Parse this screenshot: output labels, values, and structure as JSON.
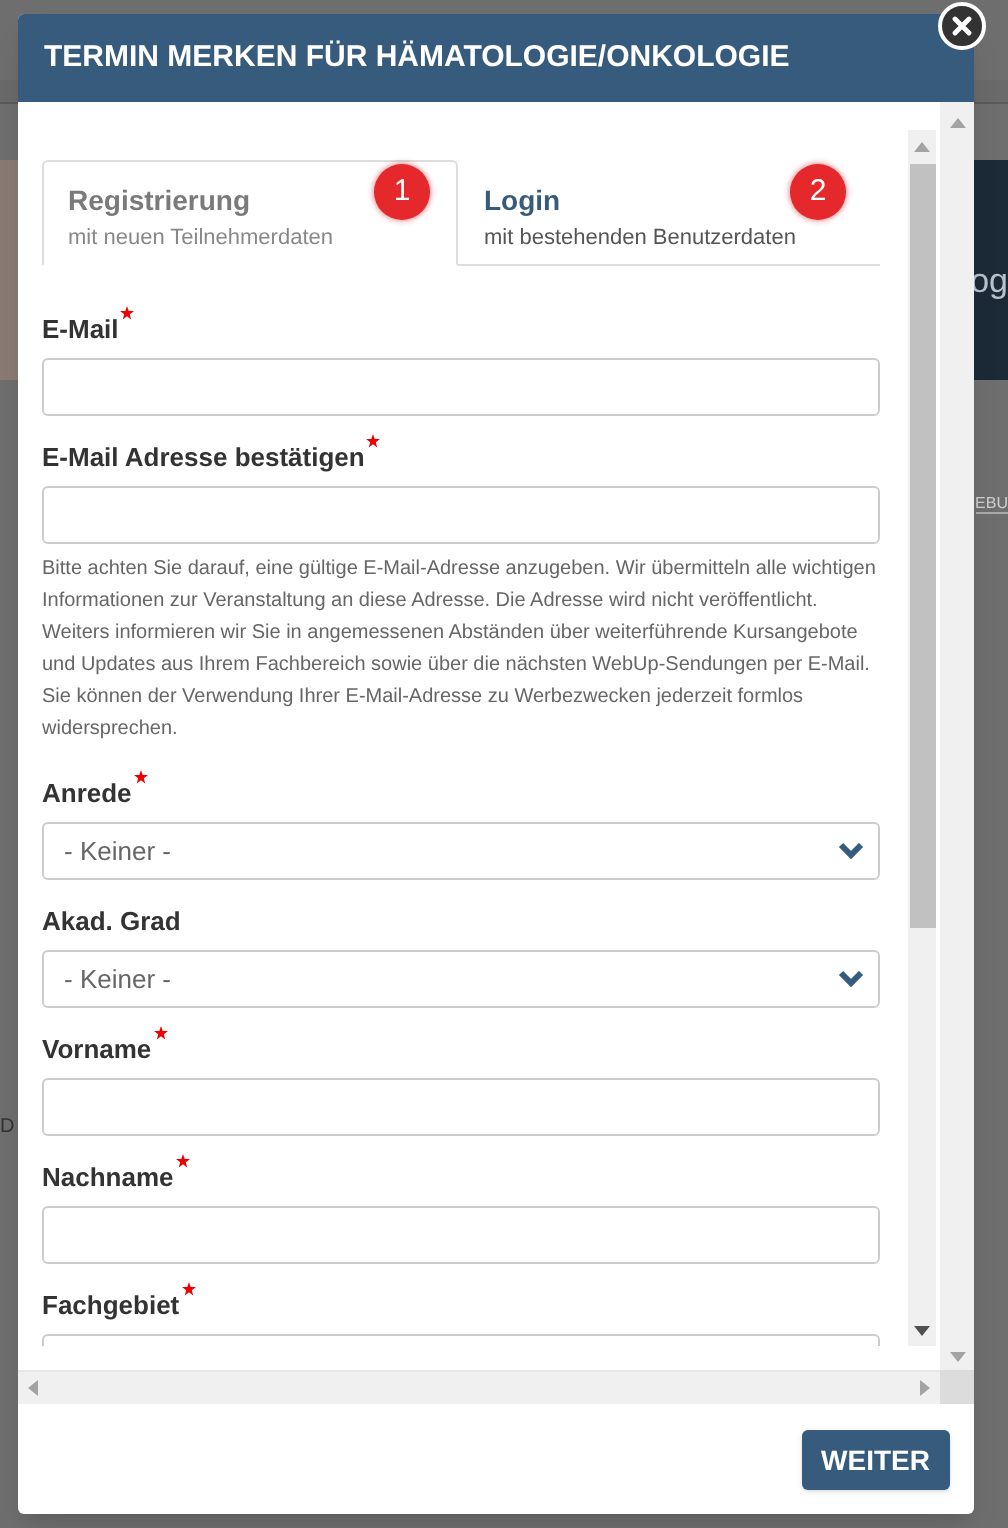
{
  "backdrop": {
    "fragments": [
      {
        "text": "og",
        "kind": "heading"
      },
      {
        "text": "EBU",
        "kind": "link"
      },
      {
        "text": "D",
        "kind": "label"
      }
    ]
  },
  "dialog": {
    "title": "TERMIN MERKEN FÜR HÄMATOLOGIE/ONKOLOGIE",
    "tabs": [
      {
        "title": "Registrierung",
        "subtitle": "mit neuen Teilnehmerdaten",
        "badge": "1",
        "selected": true
      },
      {
        "title": "Login",
        "subtitle": "mit bestehenden Benutzerdaten",
        "badge": "2",
        "selected": false
      }
    ],
    "fields": [
      {
        "kind": "input",
        "label": "E-Mail",
        "required": true
      },
      {
        "kind": "input",
        "label": "E-Mail Adresse bestätigen",
        "required": true
      },
      {
        "kind": "note",
        "lines": [
          "Bitte achten Sie darauf, eine gültige E-Mail-Adresse anzugeben. Wir übermitteln alle wichtigen Informationen zur Veranstaltung an diese Adresse. Die Adresse wird nicht veröffentlicht.",
          "Weiters informieren wir Sie in angemessenen Abständen über weiterführende Kursangebote und Updates aus Ihrem Fachbereich sowie über die nächsten WebUp-Sendungen per E-Mail. Sie können der Verwendung Ihrer E-Mail-Adresse zu Werbezwecken jederzeit formlos widersprechen."
        ]
      },
      {
        "kind": "select",
        "label": "Anrede",
        "required": true,
        "value": "- Keiner -"
      },
      {
        "kind": "select",
        "label": "Akad. Grad",
        "required": false,
        "value": "- Keiner -"
      },
      {
        "kind": "input",
        "label": "Vorname",
        "required": true
      },
      {
        "kind": "input",
        "label": "Nachname",
        "required": true
      },
      {
        "kind": "input",
        "label": "Fachgebiet",
        "required": true
      }
    ],
    "button": "WEITER"
  }
}
